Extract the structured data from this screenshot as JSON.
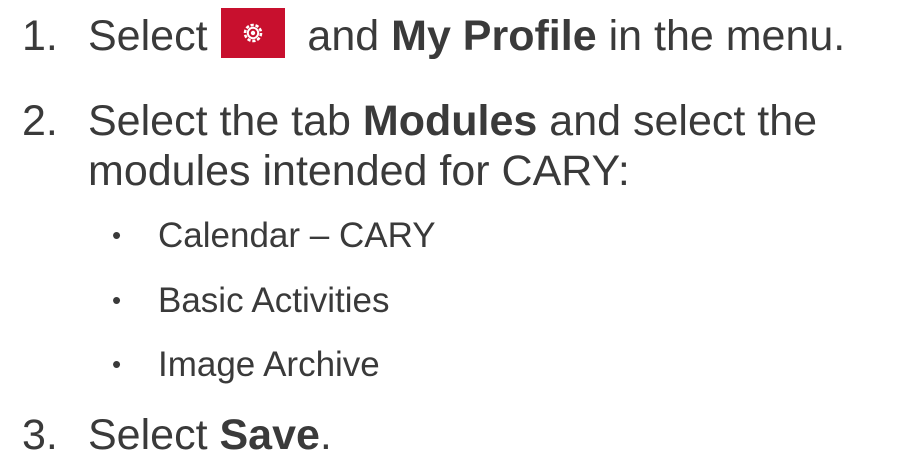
{
  "steps": [
    {
      "number": "1.",
      "t1": "Select",
      "t2": "and",
      "bold1": "My Profile",
      "t3": "in the menu.",
      "icon": "settings-gear-icon",
      "icon_bg": "#c8102e"
    },
    {
      "number": "2.",
      "t1": "Select the tab",
      "bold1": "Modules",
      "t2": "and select the",
      "line2": "modules intended for CARY:",
      "bullets": [
        "Calendar – CARY",
        "Basic Activities",
        "Image Archive"
      ]
    },
    {
      "number": "3.",
      "t1": "Select",
      "bold1": "Save",
      "t2": "."
    }
  ],
  "colors": {
    "text": "#3a3a3a",
    "accent": "#c8102e"
  }
}
